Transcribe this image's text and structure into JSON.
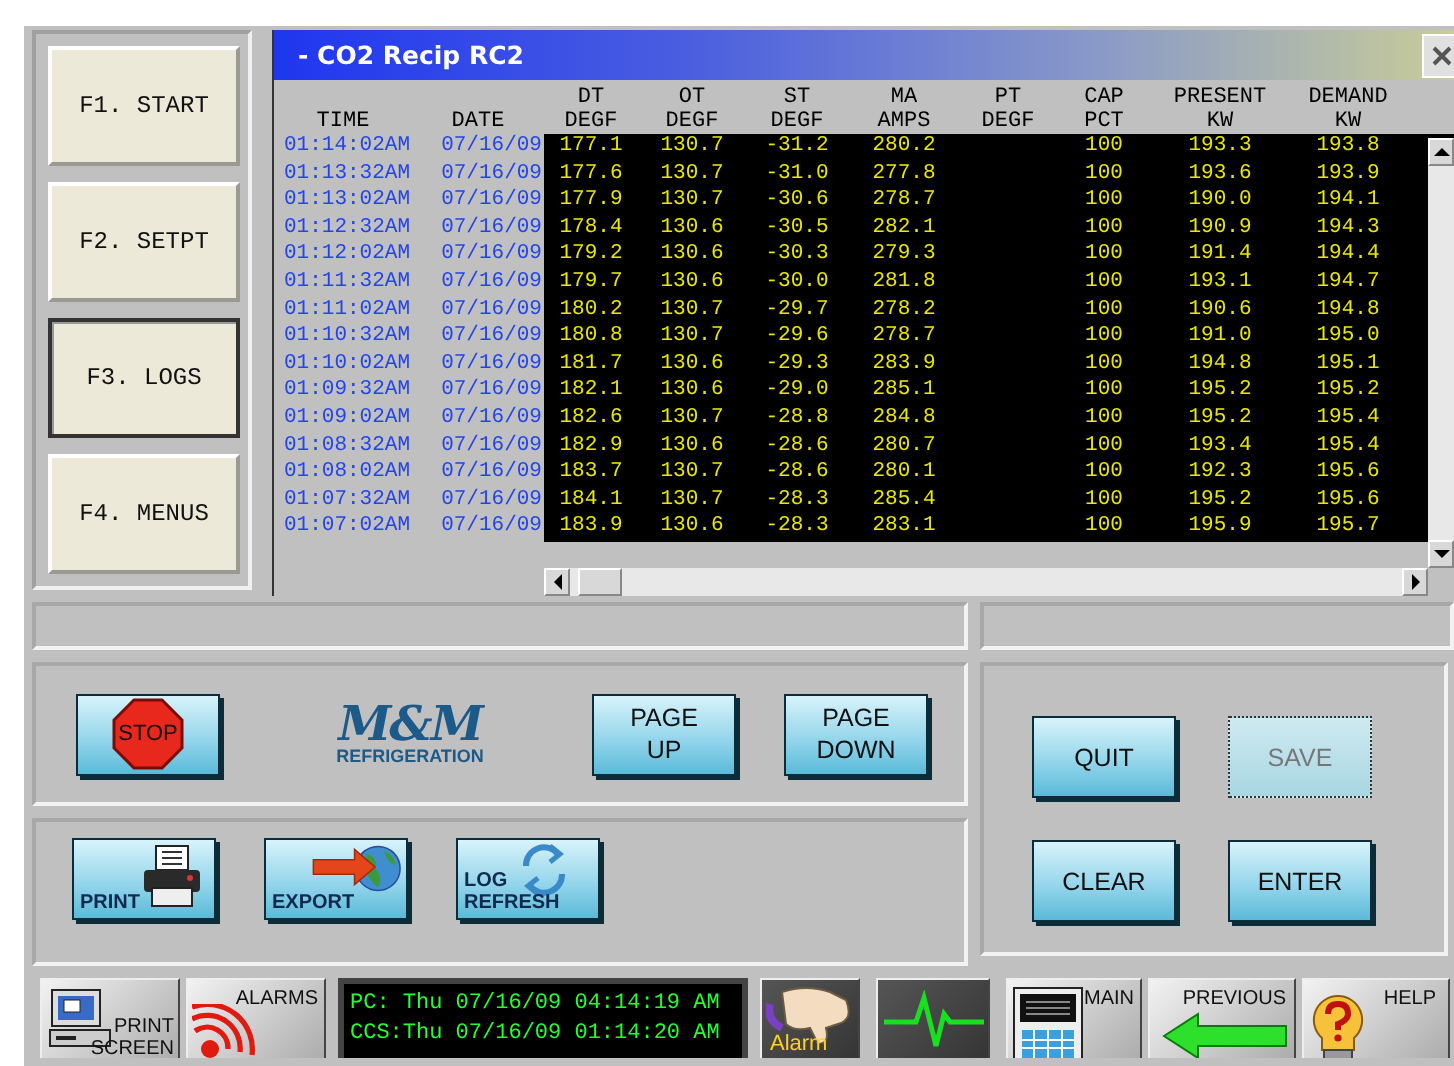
{
  "function_keys": [
    {
      "label": "F1. START",
      "selected": false
    },
    {
      "label": "F2. SETPT",
      "selected": false
    },
    {
      "label": "F3. LOGS",
      "selected": true
    },
    {
      "label": "F4. MENUS",
      "selected": false
    }
  ],
  "window": {
    "title": "- CO2 Recip RC2"
  },
  "log_table": {
    "columns": [
      {
        "lines": [
          "TIME"
        ]
      },
      {
        "lines": [
          "DATE"
        ]
      },
      {
        "lines": [
          "DT",
          "DEGF"
        ]
      },
      {
        "lines": [
          "OT",
          "DEGF"
        ]
      },
      {
        "lines": [
          "ST",
          "DEGF"
        ]
      },
      {
        "lines": [
          "MA",
          "AMPS"
        ]
      },
      {
        "lines": [
          "PT",
          "DEGF"
        ]
      },
      {
        "lines": [
          "CAP",
          "PCT"
        ]
      },
      {
        "lines": [
          "PRESENT",
          "KW"
        ]
      },
      {
        "lines": [
          "DEMAND",
          "KW"
        ]
      }
    ],
    "rows": [
      [
        "01:14:02AM",
        "07/16/09",
        "177.1",
        "130.7",
        "-31.2",
        "280.2",
        null,
        "100",
        "193.3",
        "193.8"
      ],
      [
        "01:13:32AM",
        "07/16/09",
        "177.6",
        "130.7",
        "-31.0",
        "277.8",
        null,
        "100",
        "193.6",
        "193.9"
      ],
      [
        "01:13:02AM",
        "07/16/09",
        "177.9",
        "130.7",
        "-30.6",
        "278.7",
        null,
        "100",
        "190.0",
        "194.1"
      ],
      [
        "01:12:32AM",
        "07/16/09",
        "178.4",
        "130.6",
        "-30.5",
        "282.1",
        null,
        "100",
        "190.9",
        "194.3"
      ],
      [
        "01:12:02AM",
        "07/16/09",
        "179.2",
        "130.6",
        "-30.3",
        "279.3",
        null,
        "100",
        "191.4",
        "194.4"
      ],
      [
        "01:11:32AM",
        "07/16/09",
        "179.7",
        "130.6",
        "-30.0",
        "281.8",
        null,
        "100",
        "193.1",
        "194.7"
      ],
      [
        "01:11:02AM",
        "07/16/09",
        "180.2",
        "130.7",
        "-29.7",
        "278.2",
        null,
        "100",
        "190.6",
        "194.8"
      ],
      [
        "01:10:32AM",
        "07/16/09",
        "180.8",
        "130.7",
        "-29.6",
        "278.7",
        null,
        "100",
        "191.0",
        "195.0"
      ],
      [
        "01:10:02AM",
        "07/16/09",
        "181.7",
        "130.6",
        "-29.3",
        "283.9",
        null,
        "100",
        "194.8",
        "195.1"
      ],
      [
        "01:09:32AM",
        "07/16/09",
        "182.1",
        "130.6",
        "-29.0",
        "285.1",
        null,
        "100",
        "195.2",
        "195.2"
      ],
      [
        "01:09:02AM",
        "07/16/09",
        "182.6",
        "130.7",
        "-28.8",
        "284.8",
        null,
        "100",
        "195.2",
        "195.4"
      ],
      [
        "01:08:32AM",
        "07/16/09",
        "182.9",
        "130.6",
        "-28.6",
        "280.7",
        null,
        "100",
        "193.4",
        "195.4"
      ],
      [
        "01:08:02AM",
        "07/16/09",
        "183.7",
        "130.7",
        "-28.6",
        "280.1",
        null,
        "100",
        "192.3",
        "195.6"
      ],
      [
        "01:07:32AM",
        "07/16/09",
        "184.1",
        "130.7",
        "-28.3",
        "285.4",
        null,
        "100",
        "195.2",
        "195.6"
      ],
      [
        "01:07:02AM",
        "07/16/09",
        "183.9",
        "130.6",
        "-28.3",
        "283.1",
        null,
        "100",
        "195.9",
        "195.7"
      ]
    ]
  },
  "logo": {
    "name": "M&M",
    "tagline": "REFRIGERATION"
  },
  "nav_buttons": [
    {
      "kind": "stop",
      "lines": [
        "STOP"
      ]
    },
    {
      "kind": "logo"
    },
    {
      "kind": "text",
      "lines": [
        "PAGE",
        "UP"
      ]
    },
    {
      "kind": "text",
      "lines": [
        "PAGE",
        "DOWN"
      ]
    }
  ],
  "tool_buttons": [
    {
      "kind": "print",
      "lines": [
        "PRINT"
      ]
    },
    {
      "kind": "export",
      "lines": [
        "EXPORT"
      ]
    },
    {
      "kind": "refresh",
      "lines": [
        "LOG",
        "REFRESH"
      ]
    }
  ],
  "action_buttons": [
    {
      "label": "QUIT",
      "disabled": false
    },
    {
      "label": "SAVE",
      "disabled": true
    },
    {
      "label": "CLEAR",
      "disabled": false
    },
    {
      "label": "ENTER",
      "disabled": false
    }
  ],
  "status_bar": {
    "items": [
      {
        "kind": "print_screen",
        "lines": [
          "PRINT",
          "SCREEN"
        ]
      },
      {
        "kind": "alarms",
        "lines": [
          "ALARMS"
        ]
      },
      {
        "kind": "clock",
        "lines": [
          "PC: Thu 07/16/09 04:14:19 AM",
          "CCS:Thu 07/16/09 01:14:20 AM"
        ]
      },
      {
        "kind": "alarm",
        "lines": [
          "Alarm"
        ]
      },
      {
        "kind": "heartbeat"
      },
      {
        "kind": "main",
        "lines": [
          "MAIN"
        ]
      },
      {
        "kind": "previous",
        "lines": [
          "PREVIOUS"
        ]
      },
      {
        "kind": "help",
        "lines": [
          "HELP"
        ]
      }
    ]
  }
}
